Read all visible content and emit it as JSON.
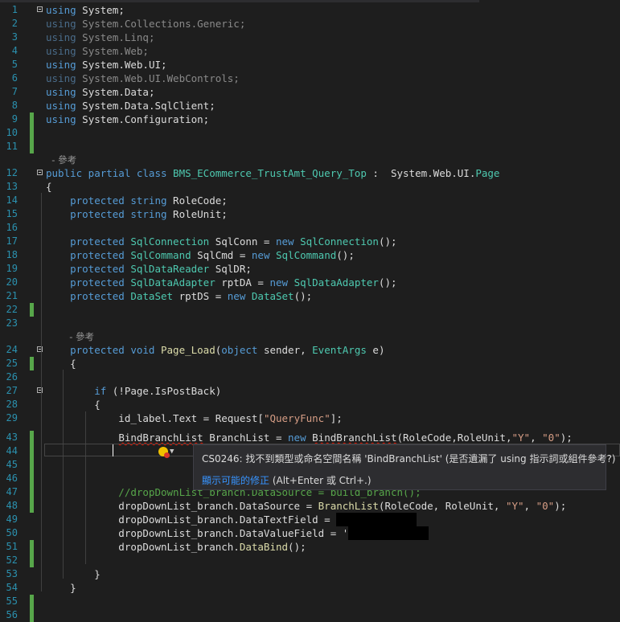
{
  "lines": [
    {
      "n": "1",
      "change": "none",
      "fold": true,
      "tokens": [
        {
          "t": "using",
          "c": "kw"
        },
        {
          "t": " System;",
          "c": "pl"
        }
      ]
    },
    {
      "n": "2",
      "change": "none",
      "tokens": [
        {
          "t": "using",
          "c": "kw"
        },
        {
          "t": " System.Collections.Generic;",
          "c": "pl"
        }
      ],
      "dim": true
    },
    {
      "n": "3",
      "change": "none",
      "tokens": [
        {
          "t": "using",
          "c": "kw"
        },
        {
          "t": " System.Linq;",
          "c": "pl"
        }
      ],
      "dim": true
    },
    {
      "n": "4",
      "change": "none",
      "tokens": [
        {
          "t": "using",
          "c": "kw"
        },
        {
          "t": " System.Web;",
          "c": "pl"
        }
      ],
      "dim": true
    },
    {
      "n": "5",
      "change": "none",
      "tokens": [
        {
          "t": "using",
          "c": "kw"
        },
        {
          "t": " System.Web.UI;",
          "c": "pl"
        }
      ]
    },
    {
      "n": "6",
      "change": "none",
      "tokens": [
        {
          "t": "using",
          "c": "kw"
        },
        {
          "t": " System.Web.UI.WebControls;",
          "c": "pl"
        }
      ],
      "dim": true
    },
    {
      "n": "7",
      "change": "none",
      "tokens": [
        {
          "t": "using",
          "c": "kw"
        },
        {
          "t": " System.Data;",
          "c": "pl"
        }
      ]
    },
    {
      "n": "8",
      "change": "none",
      "tokens": [
        {
          "t": "using",
          "c": "kw"
        },
        {
          "t": " System.Data.SqlClient;",
          "c": "pl"
        }
      ]
    },
    {
      "n": "9",
      "change": "green",
      "tokens": [
        {
          "t": "using",
          "c": "kw"
        },
        {
          "t": " System.Configuration;",
          "c": "pl"
        }
      ]
    },
    {
      "n": "10",
      "change": "green",
      "tokens": []
    },
    {
      "n": "11",
      "change": "green",
      "tokens": []
    },
    {
      "n": "",
      "ref": "  - 參考"
    },
    {
      "n": "12",
      "change": "none",
      "fold": true,
      "tokens": [
        {
          "t": "public partial class",
          "c": "kw"
        },
        {
          "t": " BMS_ECommerce_TrustAmt_Query_Top",
          "c": "ty"
        },
        {
          "t": " :  ",
          "c": "pl"
        },
        {
          "t": "System.Web.UI.",
          "c": "pl"
        },
        {
          "t": "Page",
          "c": "ty"
        }
      ]
    },
    {
      "n": "13",
      "change": "none",
      "tokens": [
        {
          "t": "{",
          "c": "pl"
        }
      ]
    },
    {
      "n": "14",
      "change": "none",
      "tokens": [
        {
          "t": "    protected string",
          "c": "kw"
        },
        {
          "t": " RoleCode;",
          "c": "pl"
        }
      ]
    },
    {
      "n": "15",
      "change": "none",
      "tokens": [
        {
          "t": "    protected string",
          "c": "kw"
        },
        {
          "t": " RoleUnit;",
          "c": "pl"
        }
      ]
    },
    {
      "n": "16",
      "change": "none",
      "tokens": []
    },
    {
      "n": "17",
      "change": "none",
      "tokens": [
        {
          "t": "    protected ",
          "c": "kw"
        },
        {
          "t": "SqlConnection",
          "c": "ty"
        },
        {
          "t": " SqlConn = ",
          "c": "pl"
        },
        {
          "t": "new ",
          "c": "kw"
        },
        {
          "t": "SqlConnection",
          "c": "ty"
        },
        {
          "t": "();",
          "c": "pl"
        }
      ]
    },
    {
      "n": "18",
      "change": "none",
      "tokens": [
        {
          "t": "    protected ",
          "c": "kw"
        },
        {
          "t": "SqlCommand",
          "c": "ty"
        },
        {
          "t": " SqlCmd = ",
          "c": "pl"
        },
        {
          "t": "new ",
          "c": "kw"
        },
        {
          "t": "SqlCommand",
          "c": "ty"
        },
        {
          "t": "();",
          "c": "pl"
        }
      ]
    },
    {
      "n": "19",
      "change": "none",
      "tokens": [
        {
          "t": "    protected ",
          "c": "kw"
        },
        {
          "t": "SqlDataReader",
          "c": "ty"
        },
        {
          "t": " SqlDR;",
          "c": "pl"
        }
      ]
    },
    {
      "n": "20",
      "change": "none",
      "tokens": [
        {
          "t": "    protected ",
          "c": "kw"
        },
        {
          "t": "SqlDataAdapter",
          "c": "ty"
        },
        {
          "t": " rptDA = ",
          "c": "pl"
        },
        {
          "t": "new ",
          "c": "kw"
        },
        {
          "t": "SqlDataAdapter",
          "c": "ty"
        },
        {
          "t": "();",
          "c": "pl"
        }
      ]
    },
    {
      "n": "21",
      "change": "none",
      "tokens": [
        {
          "t": "    protected ",
          "c": "kw"
        },
        {
          "t": "DataSet",
          "c": "ty"
        },
        {
          "t": " rptDS = ",
          "c": "pl"
        },
        {
          "t": "new ",
          "c": "kw"
        },
        {
          "t": "DataSet",
          "c": "ty"
        },
        {
          "t": "();",
          "c": "pl"
        }
      ]
    },
    {
      "n": "22",
      "change": "green",
      "tokens": []
    },
    {
      "n": "23",
      "change": "none",
      "tokens": []
    },
    {
      "n": "",
      "ref": "        - 參考"
    },
    {
      "n": "24",
      "change": "none",
      "fold": true,
      "tokens": [
        {
          "t": "    protected void",
          "c": "kw"
        },
        {
          "t": " Page_Load",
          "c": "fn"
        },
        {
          "t": "(",
          "c": "pl"
        },
        {
          "t": "object",
          "c": "kw"
        },
        {
          "t": " sender, ",
          "c": "pl"
        },
        {
          "t": "EventArgs",
          "c": "ty"
        },
        {
          "t": " e)",
          "c": "pl"
        }
      ]
    },
    {
      "n": "25",
      "change": "green",
      "tokens": [
        {
          "t": "    {",
          "c": "pl"
        }
      ]
    },
    {
      "n": "26",
      "change": "none",
      "tokens": []
    },
    {
      "n": "27",
      "change": "none",
      "fold": true,
      "tokens": [
        {
          "t": "        if",
          "c": "kw"
        },
        {
          "t": " (!Page.IsPostBack)",
          "c": "pl"
        }
      ]
    },
    {
      "n": "28",
      "change": "none",
      "tokens": [
        {
          "t": "        {",
          "c": "pl"
        }
      ]
    },
    {
      "n": "29",
      "change": "none",
      "tokens": [
        {
          "t": "            id_label.Text = Request[",
          "c": "pl"
        },
        {
          "t": "\"QueryFunc\"",
          "c": "st"
        },
        {
          "t": "];",
          "c": "pl"
        }
      ]
    },
    {
      "n": "43",
      "change": "green",
      "tokens": [
        {
          "t": "            ",
          "c": "pl"
        },
        {
          "t": "BindBranchList",
          "c": "pl",
          "sq": true
        },
        {
          "t": " BranchList = ",
          "c": "pl"
        },
        {
          "t": "new ",
          "c": "kw"
        },
        {
          "t": "BindBranchList",
          "c": "pl",
          "sq": true
        },
        {
          "t": "(RoleCode,RoleUnit,",
          "c": "pl"
        },
        {
          "t": "\"Y\"",
          "c": "st"
        },
        {
          "t": ", ",
          "c": "pl"
        },
        {
          "t": "\"0\"",
          "c": "st"
        },
        {
          "t": ");",
          "c": "pl"
        }
      ]
    },
    {
      "n": "44",
      "change": "green",
      "tokens": []
    },
    {
      "n": "45",
      "change": "green",
      "tokens": []
    },
    {
      "n": "46",
      "change": "green",
      "tokens": []
    },
    {
      "n": "47",
      "change": "green",
      "tokens": [
        {
          "t": "            //dropDownList_branch.DataSource = build_branch();",
          "c": "cmt"
        }
      ]
    },
    {
      "n": "48",
      "change": "green",
      "tokens": [
        {
          "t": "            dropDownList_branch.DataSource = ",
          "c": "pl"
        },
        {
          "t": "BranchList",
          "c": "fn"
        },
        {
          "t": "(RoleCode, RoleUnit, ",
          "c": "pl"
        },
        {
          "t": "\"Y\"",
          "c": "st"
        },
        {
          "t": ", ",
          "c": "pl"
        },
        {
          "t": "\"0\"",
          "c": "st"
        },
        {
          "t": ");",
          "c": "pl"
        }
      ]
    },
    {
      "n": "49",
      "change": "none",
      "tokens": [
        {
          "t": "            dropDownList_branch.DataTextField = ",
          "c": "pl"
        }
      ],
      "redact": true
    },
    {
      "n": "50",
      "change": "none",
      "tokens": [
        {
          "t": "            dropDownList_branch.DataValueField = '",
          "c": "pl"
        }
      ],
      "redact": true
    },
    {
      "n": "51",
      "change": "green",
      "tokens": [
        {
          "t": "            dropDownList_branch.",
          "c": "pl"
        },
        {
          "t": "DataBind",
          "c": "fn"
        },
        {
          "t": "();",
          "c": "pl"
        }
      ]
    },
    {
      "n": "52",
      "change": "green",
      "tokens": []
    },
    {
      "n": "53",
      "change": "none",
      "tokens": [
        {
          "t": "        }",
          "c": "pl"
        }
      ]
    },
    {
      "n": "54",
      "change": "none",
      "tokens": [
        {
          "t": "    }",
          "c": "pl"
        }
      ]
    },
    {
      "n": "55",
      "change": "green",
      "tokens": []
    },
    {
      "n": "56",
      "change": "green",
      "tokens": []
    }
  ],
  "tooltip": {
    "message": "CS0246: 找不到類型或命名空間名稱 'BindBranchList' (是否遺漏了 using 指示詞或組件參考?)",
    "fix_link": "顯示可能的修正",
    "fix_shortcut": " (Alt+Enter 或 Ctrl+.)"
  },
  "icons": {
    "lightbulb": "error-lightbulb-icon",
    "dropdown": "chevron-down-icon"
  },
  "colors": {
    "keyword": "#569cd6",
    "type": "#4ec9b0",
    "string": "#d69d85",
    "comment": "#57a64a",
    "method": "#dcdcaa",
    "linenumber": "#2b91af",
    "change_saved": "#57a64a"
  }
}
